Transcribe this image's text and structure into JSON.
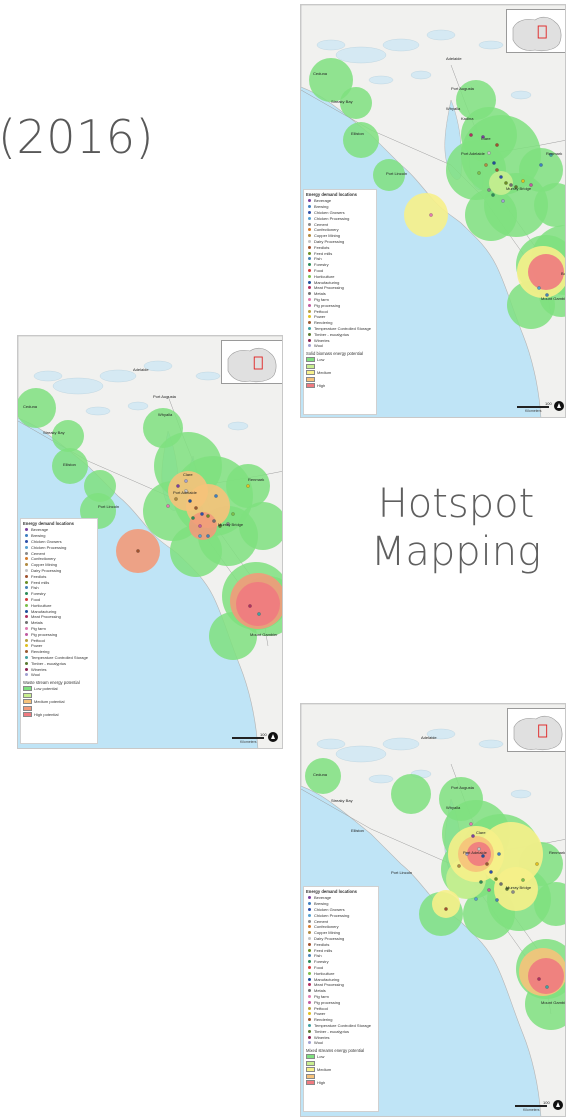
{
  "slide": {
    "year_text": "(2016)",
    "hotspot_line1": "Hotspot",
    "hotspot_line2": "Mapping"
  },
  "maps": [
    {
      "id": "top-right",
      "place_labels": [
        "Adelaide",
        "Ceduna",
        "Streaky Bay",
        "Elliston",
        "Port Lincoln",
        "Port Augusta",
        "Whyalla",
        "Clare",
        "Port Adelaide",
        "Renmark",
        "Murray Bridge",
        "Kadina",
        "Mount Gambier",
        "Bordertown"
      ],
      "legend": {
        "title": "Energy demand locations",
        "items": [
          {
            "label": "Beverage",
            "color": "#7a3fa0"
          },
          {
            "label": "Brewing",
            "color": "#3f7fc0"
          },
          {
            "label": "Chicken Growers",
            "color": "#2e4fa8"
          },
          {
            "label": "Chicken Processing",
            "color": "#56a0d0"
          },
          {
            "label": "Cement",
            "color": "#8a8a8a"
          },
          {
            "label": "Confectionery",
            "color": "#d47a2a"
          },
          {
            "label": "Copper Mining",
            "color": "#b08a40"
          },
          {
            "label": "Dairy Processing",
            "color": "#c4c4c4"
          },
          {
            "label": "Feedlots",
            "color": "#a0522d"
          },
          {
            "label": "Feed mills",
            "color": "#6b8e23"
          },
          {
            "label": "Fish",
            "color": "#4682b4"
          },
          {
            "label": "Forestry",
            "color": "#2e8b57"
          },
          {
            "label": "Food",
            "color": "#d23a3a"
          },
          {
            "label": "Horticulture",
            "color": "#7cbf4a"
          },
          {
            "label": "Manufacturing",
            "color": "#1f4f9a"
          },
          {
            "label": "Meat Processing",
            "color": "#b03060"
          },
          {
            "label": "Metals",
            "color": "#707070"
          },
          {
            "label": "Pig farm",
            "color": "#e07ab0"
          },
          {
            "label": "Pig processing",
            "color": "#c05aa0"
          },
          {
            "label": "Petfood",
            "color": "#b8a040"
          },
          {
            "label": "Power",
            "color": "#e0c020"
          },
          {
            "label": "Rendering",
            "color": "#9a5a30"
          },
          {
            "label": "Temperature Controlled Storage",
            "color": "#40a0a0"
          },
          {
            "label": "Timber - eucalyptus",
            "color": "#5a7a30"
          },
          {
            "label": "Wineries",
            "color": "#8b2252"
          },
          {
            "label": "Wool",
            "color": "#a0a0d0"
          }
        ],
        "potential_title": "Solid biomass energy potential",
        "potential": [
          {
            "label": "Low",
            "color": "#7fe07f"
          },
          {
            "label": "",
            "color": "#c8ee90"
          },
          {
            "label": "Medium",
            "color": "#f6f08a"
          },
          {
            "label": "",
            "color": "#f6c27a"
          },
          {
            "label": "High",
            "color": "#f07a80"
          }
        ]
      }
    },
    {
      "id": "middle-left",
      "place_labels": [
        "Adelaide",
        "Ceduna",
        "Streaky Bay",
        "Elliston",
        "Port Lincoln",
        "Port Augusta",
        "Whyalla",
        "Clare",
        "Port Adelaide",
        "Renmark",
        "Murray Bridge",
        "Mount Gambier"
      ],
      "legend": {
        "title": "Energy demand locations",
        "items": [
          {
            "label": "Beverage",
            "color": "#7a3fa0"
          },
          {
            "label": "Brewing",
            "color": "#3f7fc0"
          },
          {
            "label": "Chicken Growers",
            "color": "#2e4fa8"
          },
          {
            "label": "Chicken Processing",
            "color": "#56a0d0"
          },
          {
            "label": "Cement",
            "color": "#8a8a8a"
          },
          {
            "label": "Confectionery",
            "color": "#d47a2a"
          },
          {
            "label": "Copper Mining",
            "color": "#b08a40"
          },
          {
            "label": "Dairy Processing",
            "color": "#c4c4c4"
          },
          {
            "label": "Feedlots",
            "color": "#a0522d"
          },
          {
            "label": "Feed mills",
            "color": "#6b8e23"
          },
          {
            "label": "Fish",
            "color": "#4682b4"
          },
          {
            "label": "Forestry",
            "color": "#2e8b57"
          },
          {
            "label": "Food",
            "color": "#d23a3a"
          },
          {
            "label": "Horticulture",
            "color": "#7cbf4a"
          },
          {
            "label": "Manufacturing",
            "color": "#1f4f9a"
          },
          {
            "label": "Meat Processing",
            "color": "#b03060"
          },
          {
            "label": "Metals",
            "color": "#707070"
          },
          {
            "label": "Pig farm",
            "color": "#e07ab0"
          },
          {
            "label": "Pig processing",
            "color": "#c05aa0"
          },
          {
            "label": "Petfood",
            "color": "#b8a040"
          },
          {
            "label": "Power",
            "color": "#e0c020"
          },
          {
            "label": "Rendering",
            "color": "#9a5a30"
          },
          {
            "label": "Temperature Controlled Storage",
            "color": "#40a0a0"
          },
          {
            "label": "Timber - eucalyptus",
            "color": "#5a7a30"
          },
          {
            "label": "Wineries",
            "color": "#8b2252"
          },
          {
            "label": "Wool",
            "color": "#a0a0d0"
          }
        ],
        "potential_title": "Waste stream energy potential",
        "potential": [
          {
            "label": "Low potential",
            "color": "#7fe07f"
          },
          {
            "label": "",
            "color": "#c8ee90"
          },
          {
            "label": "Medium potential",
            "color": "#f6c27a"
          },
          {
            "label": "",
            "color": "#f29a7a"
          },
          {
            "label": "High potential",
            "color": "#f07a80"
          }
        ]
      }
    },
    {
      "id": "bottom-right",
      "place_labels": [
        "Adelaide",
        "Ceduna",
        "Streaky Bay",
        "Elliston",
        "Port Lincoln",
        "Port Augusta",
        "Whyalla",
        "Clare",
        "Port Adelaide",
        "Renmark",
        "Murray Bridge",
        "Mount Gambier"
      ],
      "legend": {
        "title": "Energy demand locations",
        "items": [
          {
            "label": "Beverage",
            "color": "#7a3fa0"
          },
          {
            "label": "Brewing",
            "color": "#3f7fc0"
          },
          {
            "label": "Chicken Growers",
            "color": "#2e4fa8"
          },
          {
            "label": "Chicken Processing",
            "color": "#56a0d0"
          },
          {
            "label": "Cement",
            "color": "#8a8a8a"
          },
          {
            "label": "Confectionery",
            "color": "#d47a2a"
          },
          {
            "label": "Copper Mining",
            "color": "#b08a40"
          },
          {
            "label": "Dairy Processing",
            "color": "#c4c4c4"
          },
          {
            "label": "Feedlots",
            "color": "#a0522d"
          },
          {
            "label": "Feed mills",
            "color": "#6b8e23"
          },
          {
            "label": "Fish",
            "color": "#4682b4"
          },
          {
            "label": "Forestry",
            "color": "#2e8b57"
          },
          {
            "label": "Food",
            "color": "#d23a3a"
          },
          {
            "label": "Horticulture",
            "color": "#7cbf4a"
          },
          {
            "label": "Manufacturing",
            "color": "#1f4f9a"
          },
          {
            "label": "Meat Processing",
            "color": "#b03060"
          },
          {
            "label": "Metals",
            "color": "#707070"
          },
          {
            "label": "Pig farm",
            "color": "#e07ab0"
          },
          {
            "label": "Pig processing",
            "color": "#c05aa0"
          },
          {
            "label": "Petfood",
            "color": "#b8a040"
          },
          {
            "label": "Power",
            "color": "#e0c020"
          },
          {
            "label": "Rendering",
            "color": "#9a5a30"
          },
          {
            "label": "Temperature Controlled Storage",
            "color": "#40a0a0"
          },
          {
            "label": "Timber - eucalyptus",
            "color": "#5a7a30"
          },
          {
            "label": "Wineries",
            "color": "#8b2252"
          },
          {
            "label": "Wool",
            "color": "#a0a0d0"
          }
        ],
        "potential_title": "Mixed streams energy potential",
        "potential": [
          {
            "label": "Low",
            "color": "#7fe07f"
          },
          {
            "label": "",
            "color": "#c8ee90"
          },
          {
            "label": "Medium",
            "color": "#f6f08a"
          },
          {
            "label": "",
            "color": "#f6c27a"
          },
          {
            "label": "High",
            "color": "#f07a80"
          }
        ]
      }
    }
  ],
  "scale": {
    "value": "100",
    "unit": "Kilometers"
  }
}
